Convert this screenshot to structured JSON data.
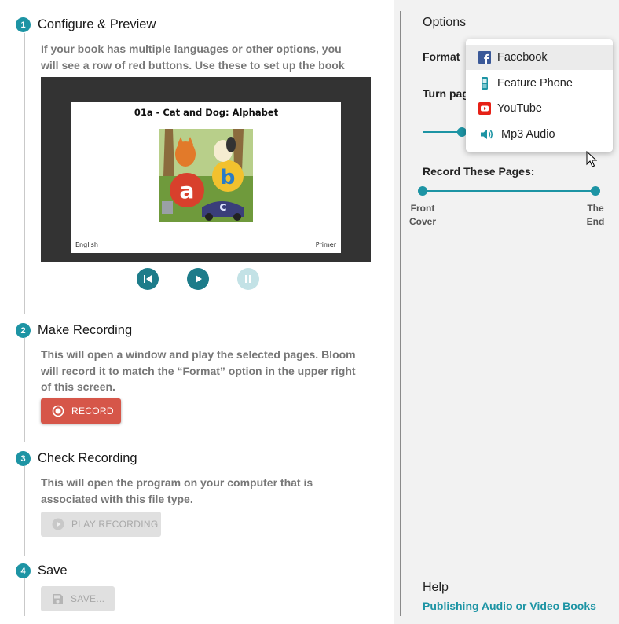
{
  "steps": [
    {
      "number": "1",
      "title": "Configure & Preview",
      "description": "If your book has multiple languages or other options, you will see a row of red buttons. Use these to set up the book for recording."
    },
    {
      "number": "2",
      "title": "Make Recording",
      "description": "This will open a window and play the selected pages. Bloom will record it to match the “Format” option in the upper right of this screen."
    },
    {
      "number": "3",
      "title": "Check Recording",
      "description": "This will open the program on your computer that is associated with this file type."
    },
    {
      "number": "4",
      "title": "Save",
      "description": ""
    }
  ],
  "preview": {
    "page_title": "01a - Cat and Dog: Alphabet",
    "language": "English",
    "level": "Primer"
  },
  "playback": {
    "buttons": [
      {
        "icon": "skip-to-start-icon",
        "enabled": true
      },
      {
        "icon": "play-icon",
        "enabled": true
      },
      {
        "icon": "pause-icon",
        "enabled": false
      }
    ]
  },
  "buttons": {
    "record_label": "RECORD",
    "play_recording_label": "PLAY RECORDING",
    "save_label": "SAVE..."
  },
  "options": {
    "title": "Options",
    "format_label": "Format",
    "turn_pages_label": "Turn pag",
    "record_pages_label": "Record These Pages:",
    "range_start_line1": "Front",
    "range_start_line2": "Cover",
    "range_end_line1": "The",
    "range_end_line2": "End"
  },
  "format_menu": {
    "selected": "Facebook",
    "items": [
      {
        "label": "Facebook",
        "icon": "facebook-icon"
      },
      {
        "label": "Feature Phone",
        "icon": "phone-icon"
      },
      {
        "label": "YouTube",
        "icon": "youtube-icon"
      },
      {
        "label": "Mp3 Audio",
        "icon": "speaker-icon"
      }
    ]
  },
  "help": {
    "title": "Help",
    "link": "Publishing Audio or Video Books"
  },
  "colors": {
    "accent": "#1d94a4",
    "record": "#d65649",
    "disabled_bg": "#e0e0e0",
    "facebook": "#3b5998",
    "youtube": "#e62117"
  }
}
